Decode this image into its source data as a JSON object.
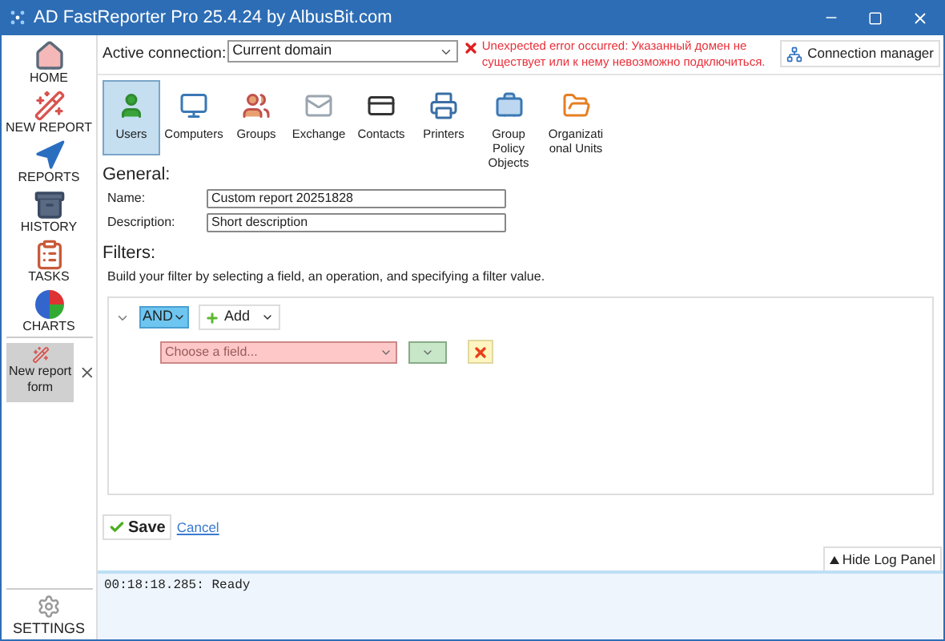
{
  "window": {
    "title": "AD FastReporter Pro 25.4.24 by AlbusBit.com"
  },
  "sidebar": {
    "items": [
      {
        "label": "HOME",
        "kind": "home"
      },
      {
        "label": "NEW REPORT",
        "kind": "new"
      },
      {
        "label": "REPORTS",
        "kind": "reports"
      },
      {
        "label": "HISTORY",
        "kind": "history"
      },
      {
        "label": "TASKS",
        "kind": "tasks"
      },
      {
        "label": "CHARTS",
        "kind": "charts"
      }
    ],
    "open_forms": [
      {
        "label": "New report form",
        "selected": true
      }
    ],
    "settings": "SETTINGS"
  },
  "connection": {
    "label": "Active connection:",
    "value": "Current domain",
    "error": "Unexpected error occurred: Указанный домен не существует или к нему невозможно подключиться.",
    "manager_button": "Connection manager"
  },
  "object_types": [
    {
      "label": "Users",
      "kind": "users",
      "selected": true
    },
    {
      "label": "Computers",
      "kind": "computers",
      "selected": false
    },
    {
      "label": "Groups",
      "kind": "groups",
      "selected": false
    },
    {
      "label": "Exchange",
      "kind": "exchange",
      "selected": false
    },
    {
      "label": "Contacts",
      "kind": "contacts",
      "selected": false
    },
    {
      "label": "Printers",
      "kind": "printers",
      "selected": false
    },
    {
      "label": "Group Policy Objects",
      "kind": "gpo",
      "selected": false
    },
    {
      "label": "Organizational Units",
      "kind": "ou",
      "selected": false
    }
  ],
  "general": {
    "title": "General:",
    "fields": [
      {
        "label": "Name:",
        "value": "Custom report 20251828"
      },
      {
        "label": "Description:",
        "value": "Short description"
      }
    ]
  },
  "filters": {
    "title": "Filters:",
    "hint": "Build your filter by selecting a field, an operation, and specifying a filter value.",
    "operator": "AND",
    "add_button": "Add",
    "conditions": [
      {
        "placeholder": "Choose a field..."
      }
    ]
  },
  "actions": {
    "save": "Save",
    "cancel": "Cancel"
  },
  "log": {
    "toggle": "Hide Log Panel",
    "lines": [
      "00:18:18.285: Ready"
    ]
  }
}
